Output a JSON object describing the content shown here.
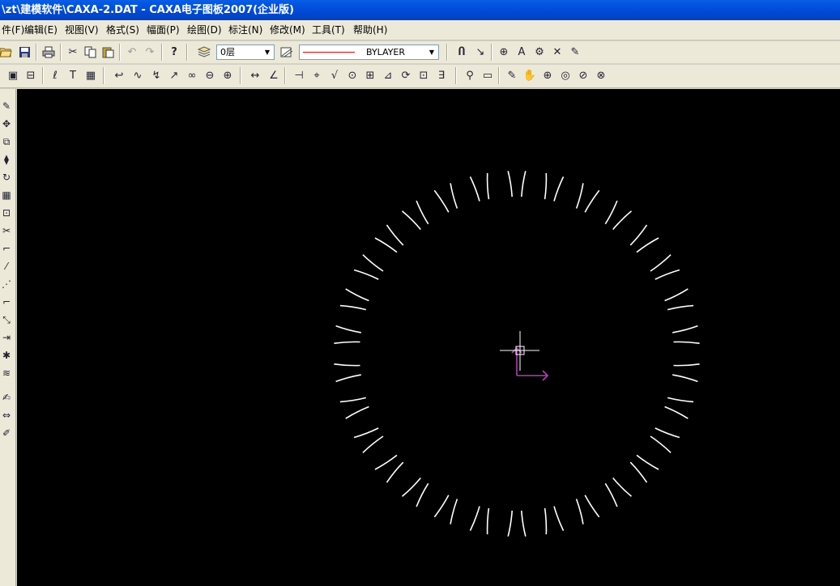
{
  "window": {
    "title": "\\zt\\建模软件\\CAXA-2.DAT - CAXA电子图板2007(企业版)"
  },
  "menu": [
    {
      "label": "件(F)"
    },
    {
      "label": "编辑(E)"
    },
    {
      "label": "视图(V)"
    },
    {
      "label": "格式(S)"
    },
    {
      "label": "幅面(P)"
    },
    {
      "label": "绘图(D)"
    },
    {
      "label": "标注(N)"
    },
    {
      "label": "修改(M)"
    },
    {
      "label": "工具(T)"
    },
    {
      "label": "帮助(H)"
    }
  ],
  "toolbar": {
    "layer_value": "0层",
    "linetype_value": "BYLAYER",
    "icons": {
      "open": "open-folder-icon",
      "save": "save-disk-icon",
      "print": "printer-icon",
      "cut": "scissors-icon",
      "copy": "copy-icon",
      "paste": "paste-icon",
      "undo": "undo-icon",
      "redo": "redo-icon",
      "help": "help-question-icon"
    }
  },
  "drawing": {
    "background": "#000000",
    "stroke": "#ffffff",
    "ucs_color": "#b040b0",
    "tooth_count": 30
  }
}
